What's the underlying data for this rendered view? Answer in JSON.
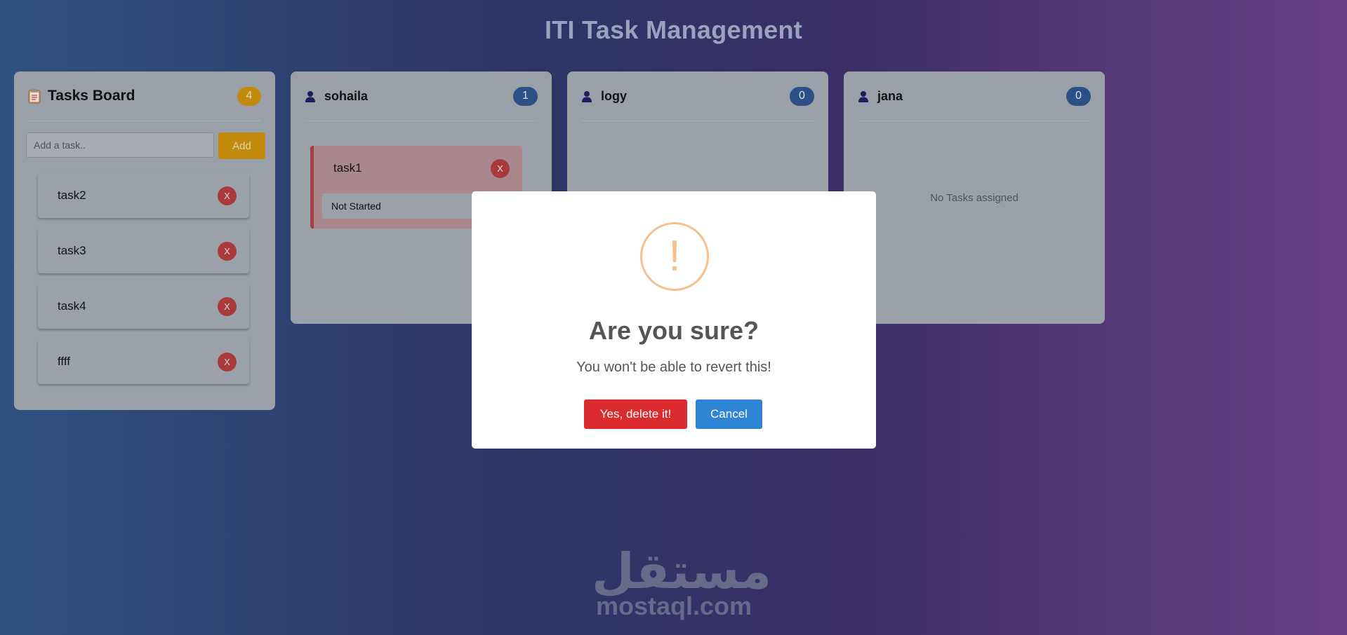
{
  "page_title": "ITI Task Management",
  "tasks_board": {
    "title": "Tasks Board",
    "count": "4",
    "input_placeholder": "Add a task..",
    "add_label": "Add",
    "tasks": [
      {
        "name": "task2",
        "delete_label": "X"
      },
      {
        "name": "task3",
        "delete_label": "X"
      },
      {
        "name": "task4",
        "delete_label": "X"
      },
      {
        "name": "ffff",
        "delete_label": "X"
      }
    ]
  },
  "users": [
    {
      "name": "sohaila",
      "count": "1",
      "tasks": [
        {
          "name": "task1",
          "status": "Not Started",
          "delete_label": "X"
        }
      ],
      "empty_text": ""
    },
    {
      "name": "logy",
      "count": "0",
      "tasks": [],
      "empty_text": ""
    },
    {
      "name": "jana",
      "count": "0",
      "tasks": [],
      "empty_text": "No Tasks assigned"
    }
  ],
  "dialog": {
    "icon": "!",
    "title": "Are you sure?",
    "text": "You won't be able to revert this!",
    "confirm_label": "Yes, delete it!",
    "cancel_label": "Cancel"
  },
  "watermark": {
    "arabic": "مستقل",
    "url": "mostaql.com"
  },
  "colors": {
    "danger": "#dc2b2f",
    "primary": "#2f84d6",
    "warning": "#f6c08c",
    "accent": "#c28b0b",
    "badge_blue": "#2c4f86"
  }
}
